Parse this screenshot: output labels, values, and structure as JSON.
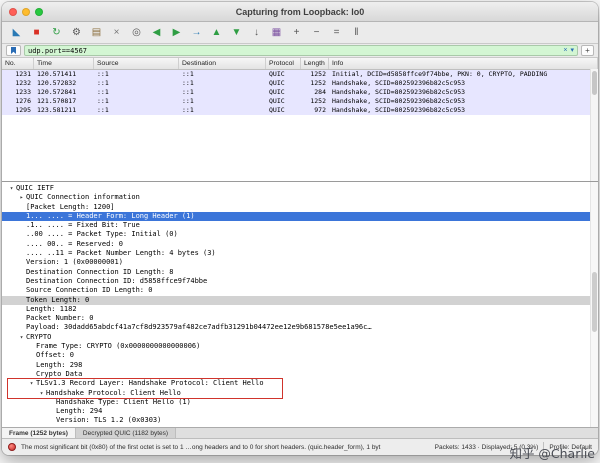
{
  "window": {
    "title": "Capturing from Loopback: lo0"
  },
  "colors": {
    "accent-blue": "#2a6db5",
    "filter-green": "#d3f6d3",
    "row-lavender": "#e7e6ff",
    "selection-blue": "#3b75d9",
    "annotation-red": "#d0342c"
  },
  "toolbar": {
    "icons": [
      {
        "name": "capture-start-icon",
        "glyph": "◣",
        "color": "#2a7ab5"
      },
      {
        "name": "capture-stop-icon",
        "glyph": "■",
        "color": "#d93025"
      },
      {
        "name": "capture-restart-icon",
        "glyph": "↻",
        "color": "#2f9e44"
      },
      {
        "name": "capture-options-icon",
        "glyph": "⚙",
        "color": "#555555"
      },
      {
        "name": "open-file-icon",
        "glyph": "▤",
        "color": "#8a6d3b"
      },
      {
        "name": "close-file-icon",
        "glyph": "×",
        "color": "#777777"
      },
      {
        "name": "find-packet-icon",
        "glyph": "◎",
        "color": "#555555"
      },
      {
        "name": "previous-packet-icon",
        "glyph": "◀",
        "color": "#2f9e44"
      },
      {
        "name": "next-packet-icon",
        "glyph": "▶",
        "color": "#2f9e44"
      },
      {
        "name": "goto-packet-icon",
        "glyph": "→",
        "color": "#2a7ab5"
      },
      {
        "name": "first-packet-icon",
        "glyph": "▲",
        "color": "#2f9e44"
      },
      {
        "name": "last-packet-icon",
        "glyph": "▼",
        "color": "#2f9e44"
      },
      {
        "name": "autoscroll-icon",
        "glyph": "↓",
        "color": "#555555"
      },
      {
        "name": "colorize-icon",
        "glyph": "▦",
        "color": "#7a4ea0"
      },
      {
        "name": "zoom-in-icon",
        "glyph": "+",
        "color": "#555555"
      },
      {
        "name": "zoom-out-icon",
        "glyph": "−",
        "color": "#555555"
      },
      {
        "name": "zoom-reset-icon",
        "glyph": "=",
        "color": "#555555"
      },
      {
        "name": "resize-columns-icon",
        "glyph": "‖",
        "color": "#555555"
      }
    ]
  },
  "filter": {
    "value": "udp.port==4567",
    "add_label": "+"
  },
  "packet_list": {
    "columns": [
      "No.",
      "Time",
      "Source",
      "Destination",
      "Protocol",
      "Length",
      "Info"
    ],
    "rows": [
      {
        "no": "1231",
        "time": "120.571411",
        "source": "::1",
        "destination": "::1",
        "protocol": "QUIC",
        "length": "1252",
        "info": "Initial, DCID=d5858ffce9f74bbe, PKN: 0, CRYPTO, PADDING"
      },
      {
        "no": "1232",
        "time": "120.572832",
        "source": "::1",
        "destination": "::1",
        "protocol": "QUIC",
        "length": "1252",
        "info": "Handshake, SCID=802592396b82c5c953"
      },
      {
        "no": "1233",
        "time": "120.572841",
        "source": "::1",
        "destination": "::1",
        "protocol": "QUIC",
        "length": "284",
        "info": "Handshake, SCID=802592396b82c5c953"
      },
      {
        "no": "1276",
        "time": "121.570817",
        "source": "::1",
        "destination": "::1",
        "protocol": "QUIC",
        "length": "1252",
        "info": "Handshake, SCID=802592396b82c5c953"
      },
      {
        "no": "1295",
        "time": "123.581211",
        "source": "::1",
        "destination": "::1",
        "protocol": "QUIC",
        "length": "972",
        "info": "Handshake, SCID=802592396b82c5c953"
      }
    ]
  },
  "details": {
    "lines": [
      {
        "indent": 0,
        "arrow": "v",
        "text": "QUIC IETF"
      },
      {
        "indent": 1,
        "arrow": ">",
        "text": "QUIC Connection information"
      },
      {
        "indent": 1,
        "arrow": "",
        "text": "[Packet Length: 1200]"
      },
      {
        "indent": 1,
        "arrow": "",
        "text": "1... .... = Header Form: Long Header (1)",
        "state": "selected"
      },
      {
        "indent": 1,
        "arrow": "",
        "text": ".1.. .... = Fixed Bit: True"
      },
      {
        "indent": 1,
        "arrow": "",
        "text": "..00 .... = Packet Type: Initial (0)"
      },
      {
        "indent": 1,
        "arrow": "",
        "text": ".... 00.. = Reserved: 0"
      },
      {
        "indent": 1,
        "arrow": "",
        "text": ".... ..11 = Packet Number Length: 4 bytes (3)"
      },
      {
        "indent": 1,
        "arrow": "",
        "text": "Version: 1 (0x00000001)"
      },
      {
        "indent": 1,
        "arrow": "",
        "text": "Destination Connection ID Length: 8"
      },
      {
        "indent": 1,
        "arrow": "",
        "text": "Destination Connection ID: d5858ffce9f74bbe"
      },
      {
        "indent": 1,
        "arrow": "",
        "text": "Source Connection ID Length: 0"
      },
      {
        "indent": 1,
        "arrow": "",
        "text": "Token Length: 0",
        "state": "highlight"
      },
      {
        "indent": 1,
        "arrow": "",
        "text": "Length: 1182"
      },
      {
        "indent": 1,
        "arrow": "",
        "text": "Packet Number: 0"
      },
      {
        "indent": 1,
        "arrow": "",
        "text": "Payload: 30dadd65abdcf41a7cf8d923579af482ce7adfb31291b04472ee12e9b681578e5ee1a96c…"
      },
      {
        "indent": 1,
        "arrow": "v",
        "text": "CRYPTO"
      },
      {
        "indent": 2,
        "arrow": "",
        "text": "Frame Type: CRYPTO (0x0000000000000006)"
      },
      {
        "indent": 2,
        "arrow": "",
        "text": "Offset: 0"
      },
      {
        "indent": 2,
        "arrow": "",
        "text": "Length: 298"
      },
      {
        "indent": 2,
        "arrow": "",
        "text": "Crypto Data"
      },
      {
        "indent": 2,
        "arrow": "v",
        "text": "TLSv1.3 Record Layer: Handshake Protocol: Client Hello",
        "redbox": true
      },
      {
        "indent": 3,
        "arrow": "v",
        "text": "Handshake Protocol: Client Hello",
        "redbox": true
      },
      {
        "indent": 4,
        "arrow": "",
        "text": "Handshake Type: Client Hello (1)"
      },
      {
        "indent": 4,
        "arrow": "",
        "text": "Length: 294"
      },
      {
        "indent": 4,
        "arrow": "",
        "text": "Version: TLS 1.2 (0x0303)"
      }
    ]
  },
  "byte_tabs": [
    {
      "label": "Frame (1252 bytes)",
      "active": true
    },
    {
      "label": "Decrypted QUIC (1182 bytes)",
      "active": false
    }
  ],
  "status": {
    "message": "The most significant bit (0x80) of the first octet is set to 1 …ong headers and to 0 for short headers. (quic.header_form), 1 byt",
    "packets": "Packets: 1433 · Displayed: 5 (0.3%)",
    "profile": "Profile: Default"
  },
  "watermark": "知乎 @Charlie"
}
